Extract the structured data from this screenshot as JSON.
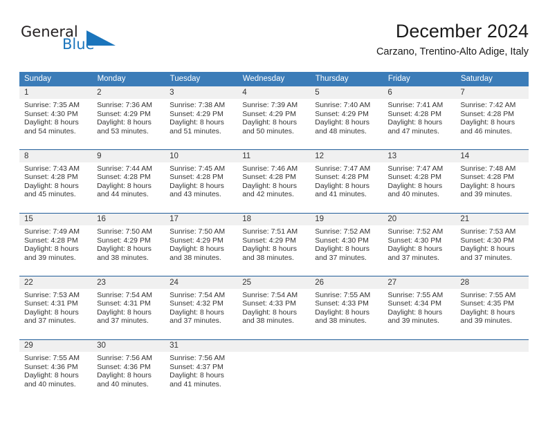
{
  "brand": {
    "name_part1": "General",
    "name_part2": "Blue",
    "logo_icon": "triangle-logo-icon",
    "accent_color": "#1b75bc"
  },
  "header": {
    "title": "December 2024",
    "subtitle": "Carzano, Trentino-Alto Adige, Italy"
  },
  "theme": {
    "header_bg": "#3b7cb8",
    "row_separator": "#1f5c99",
    "daynum_bg": "#f0f0f0"
  },
  "weekdays": [
    "Sunday",
    "Monday",
    "Tuesday",
    "Wednesday",
    "Thursday",
    "Friday",
    "Saturday"
  ],
  "weeks": [
    [
      {
        "day": "1",
        "sunrise": "Sunrise: 7:35 AM",
        "sunset": "Sunset: 4:30 PM",
        "daylight1": "Daylight: 8 hours",
        "daylight2": "and 54 minutes."
      },
      {
        "day": "2",
        "sunrise": "Sunrise: 7:36 AM",
        "sunset": "Sunset: 4:29 PM",
        "daylight1": "Daylight: 8 hours",
        "daylight2": "and 53 minutes."
      },
      {
        "day": "3",
        "sunrise": "Sunrise: 7:38 AM",
        "sunset": "Sunset: 4:29 PM",
        "daylight1": "Daylight: 8 hours",
        "daylight2": "and 51 minutes."
      },
      {
        "day": "4",
        "sunrise": "Sunrise: 7:39 AM",
        "sunset": "Sunset: 4:29 PM",
        "daylight1": "Daylight: 8 hours",
        "daylight2": "and 50 minutes."
      },
      {
        "day": "5",
        "sunrise": "Sunrise: 7:40 AM",
        "sunset": "Sunset: 4:29 PM",
        "daylight1": "Daylight: 8 hours",
        "daylight2": "and 48 minutes."
      },
      {
        "day": "6",
        "sunrise": "Sunrise: 7:41 AM",
        "sunset": "Sunset: 4:28 PM",
        "daylight1": "Daylight: 8 hours",
        "daylight2": "and 47 minutes."
      },
      {
        "day": "7",
        "sunrise": "Sunrise: 7:42 AM",
        "sunset": "Sunset: 4:28 PM",
        "daylight1": "Daylight: 8 hours",
        "daylight2": "and 46 minutes."
      }
    ],
    [
      {
        "day": "8",
        "sunrise": "Sunrise: 7:43 AM",
        "sunset": "Sunset: 4:28 PM",
        "daylight1": "Daylight: 8 hours",
        "daylight2": "and 45 minutes."
      },
      {
        "day": "9",
        "sunrise": "Sunrise: 7:44 AM",
        "sunset": "Sunset: 4:28 PM",
        "daylight1": "Daylight: 8 hours",
        "daylight2": "and 44 minutes."
      },
      {
        "day": "10",
        "sunrise": "Sunrise: 7:45 AM",
        "sunset": "Sunset: 4:28 PM",
        "daylight1": "Daylight: 8 hours",
        "daylight2": "and 43 minutes."
      },
      {
        "day": "11",
        "sunrise": "Sunrise: 7:46 AM",
        "sunset": "Sunset: 4:28 PM",
        "daylight1": "Daylight: 8 hours",
        "daylight2": "and 42 minutes."
      },
      {
        "day": "12",
        "sunrise": "Sunrise: 7:47 AM",
        "sunset": "Sunset: 4:28 PM",
        "daylight1": "Daylight: 8 hours",
        "daylight2": "and 41 minutes."
      },
      {
        "day": "13",
        "sunrise": "Sunrise: 7:47 AM",
        "sunset": "Sunset: 4:28 PM",
        "daylight1": "Daylight: 8 hours",
        "daylight2": "and 40 minutes."
      },
      {
        "day": "14",
        "sunrise": "Sunrise: 7:48 AM",
        "sunset": "Sunset: 4:28 PM",
        "daylight1": "Daylight: 8 hours",
        "daylight2": "and 39 minutes."
      }
    ],
    [
      {
        "day": "15",
        "sunrise": "Sunrise: 7:49 AM",
        "sunset": "Sunset: 4:28 PM",
        "daylight1": "Daylight: 8 hours",
        "daylight2": "and 39 minutes."
      },
      {
        "day": "16",
        "sunrise": "Sunrise: 7:50 AM",
        "sunset": "Sunset: 4:29 PM",
        "daylight1": "Daylight: 8 hours",
        "daylight2": "and 38 minutes."
      },
      {
        "day": "17",
        "sunrise": "Sunrise: 7:50 AM",
        "sunset": "Sunset: 4:29 PM",
        "daylight1": "Daylight: 8 hours",
        "daylight2": "and 38 minutes."
      },
      {
        "day": "18",
        "sunrise": "Sunrise: 7:51 AM",
        "sunset": "Sunset: 4:29 PM",
        "daylight1": "Daylight: 8 hours",
        "daylight2": "and 38 minutes."
      },
      {
        "day": "19",
        "sunrise": "Sunrise: 7:52 AM",
        "sunset": "Sunset: 4:30 PM",
        "daylight1": "Daylight: 8 hours",
        "daylight2": "and 37 minutes."
      },
      {
        "day": "20",
        "sunrise": "Sunrise: 7:52 AM",
        "sunset": "Sunset: 4:30 PM",
        "daylight1": "Daylight: 8 hours",
        "daylight2": "and 37 minutes."
      },
      {
        "day": "21",
        "sunrise": "Sunrise: 7:53 AM",
        "sunset": "Sunset: 4:30 PM",
        "daylight1": "Daylight: 8 hours",
        "daylight2": "and 37 minutes."
      }
    ],
    [
      {
        "day": "22",
        "sunrise": "Sunrise: 7:53 AM",
        "sunset": "Sunset: 4:31 PM",
        "daylight1": "Daylight: 8 hours",
        "daylight2": "and 37 minutes."
      },
      {
        "day": "23",
        "sunrise": "Sunrise: 7:54 AM",
        "sunset": "Sunset: 4:31 PM",
        "daylight1": "Daylight: 8 hours",
        "daylight2": "and 37 minutes."
      },
      {
        "day": "24",
        "sunrise": "Sunrise: 7:54 AM",
        "sunset": "Sunset: 4:32 PM",
        "daylight1": "Daylight: 8 hours",
        "daylight2": "and 37 minutes."
      },
      {
        "day": "25",
        "sunrise": "Sunrise: 7:54 AM",
        "sunset": "Sunset: 4:33 PM",
        "daylight1": "Daylight: 8 hours",
        "daylight2": "and 38 minutes."
      },
      {
        "day": "26",
        "sunrise": "Sunrise: 7:55 AM",
        "sunset": "Sunset: 4:33 PM",
        "daylight1": "Daylight: 8 hours",
        "daylight2": "and 38 minutes."
      },
      {
        "day": "27",
        "sunrise": "Sunrise: 7:55 AM",
        "sunset": "Sunset: 4:34 PM",
        "daylight1": "Daylight: 8 hours",
        "daylight2": "and 39 minutes."
      },
      {
        "day": "28",
        "sunrise": "Sunrise: 7:55 AM",
        "sunset": "Sunset: 4:35 PM",
        "daylight1": "Daylight: 8 hours",
        "daylight2": "and 39 minutes."
      }
    ],
    [
      {
        "day": "29",
        "sunrise": "Sunrise: 7:55 AM",
        "sunset": "Sunset: 4:36 PM",
        "daylight1": "Daylight: 8 hours",
        "daylight2": "and 40 minutes."
      },
      {
        "day": "30",
        "sunrise": "Sunrise: 7:56 AM",
        "sunset": "Sunset: 4:36 PM",
        "daylight1": "Daylight: 8 hours",
        "daylight2": "and 40 minutes."
      },
      {
        "day": "31",
        "sunrise": "Sunrise: 7:56 AM",
        "sunset": "Sunset: 4:37 PM",
        "daylight1": "Daylight: 8 hours",
        "daylight2": "and 41 minutes."
      },
      {
        "day": "",
        "sunrise": "",
        "sunset": "",
        "daylight1": "",
        "daylight2": ""
      },
      {
        "day": "",
        "sunrise": "",
        "sunset": "",
        "daylight1": "",
        "daylight2": ""
      },
      {
        "day": "",
        "sunrise": "",
        "sunset": "",
        "daylight1": "",
        "daylight2": ""
      },
      {
        "day": "",
        "sunrise": "",
        "sunset": "",
        "daylight1": "",
        "daylight2": ""
      }
    ]
  ]
}
